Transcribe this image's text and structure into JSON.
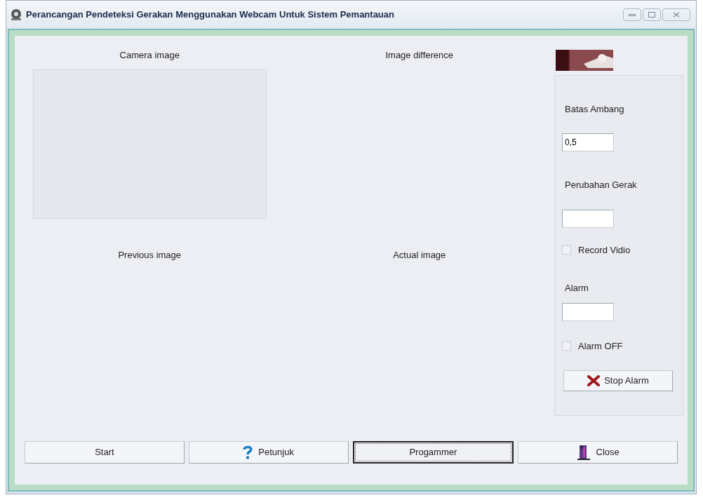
{
  "window": {
    "title": "Perancangan Pendeteksi Gerakan Menggunakan Webcam Untuk Sistem Pemantauan"
  },
  "views": [
    {
      "label": "Camera image"
    },
    {
      "label": "Image difference"
    },
    {
      "label": "Previous image"
    },
    {
      "label": "Actual image"
    }
  ],
  "side_panel": [
    {
      "kind": "label",
      "text": "Batas Ambang"
    },
    {
      "kind": "field",
      "value": "0,5"
    },
    {
      "kind": "label",
      "text": "Perubahan Gerak"
    },
    {
      "kind": "field"
    },
    {
      "kind": "checkbox",
      "text": "Record Vidio",
      "checked": false
    },
    {
      "kind": "label",
      "text": "Alarm"
    },
    {
      "kind": "field"
    },
    {
      "kind": "checkbox",
      "text": "Alarm OFF",
      "checked": false
    },
    {
      "kind": "button",
      "text": "Stop Alarm"
    }
  ],
  "buttons": [
    {
      "label": "Start",
      "focused": false
    },
    {
      "label": "Petunjuk",
      "focused": false
    },
    {
      "label": "Progammer",
      "focused": true
    },
    {
      "label": "Close",
      "focused": false
    }
  ]
}
